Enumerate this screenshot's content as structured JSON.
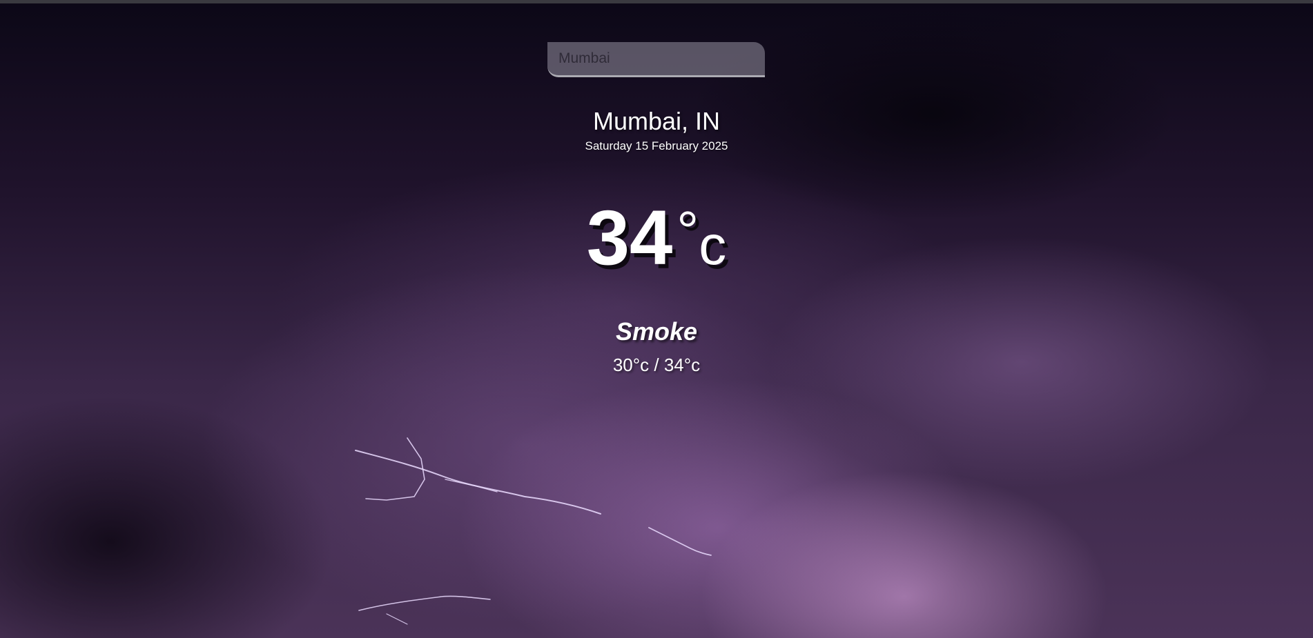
{
  "search": {
    "placeholder": "Mumbai",
    "value": ""
  },
  "location": {
    "city": "Mumbai, IN",
    "date": "Saturday 15 February 2025"
  },
  "weather": {
    "temperature": "34",
    "unit_degree": "°",
    "unit_letter": "c",
    "condition": "Smoke",
    "hi_low": "30°c / 34°c"
  },
  "colors": {
    "text": "#ffffff",
    "background_dark": "#0c0817",
    "background_light": "#4b3358"
  },
  "background": {
    "description_icon": "storm-clouds-lightning-background"
  }
}
